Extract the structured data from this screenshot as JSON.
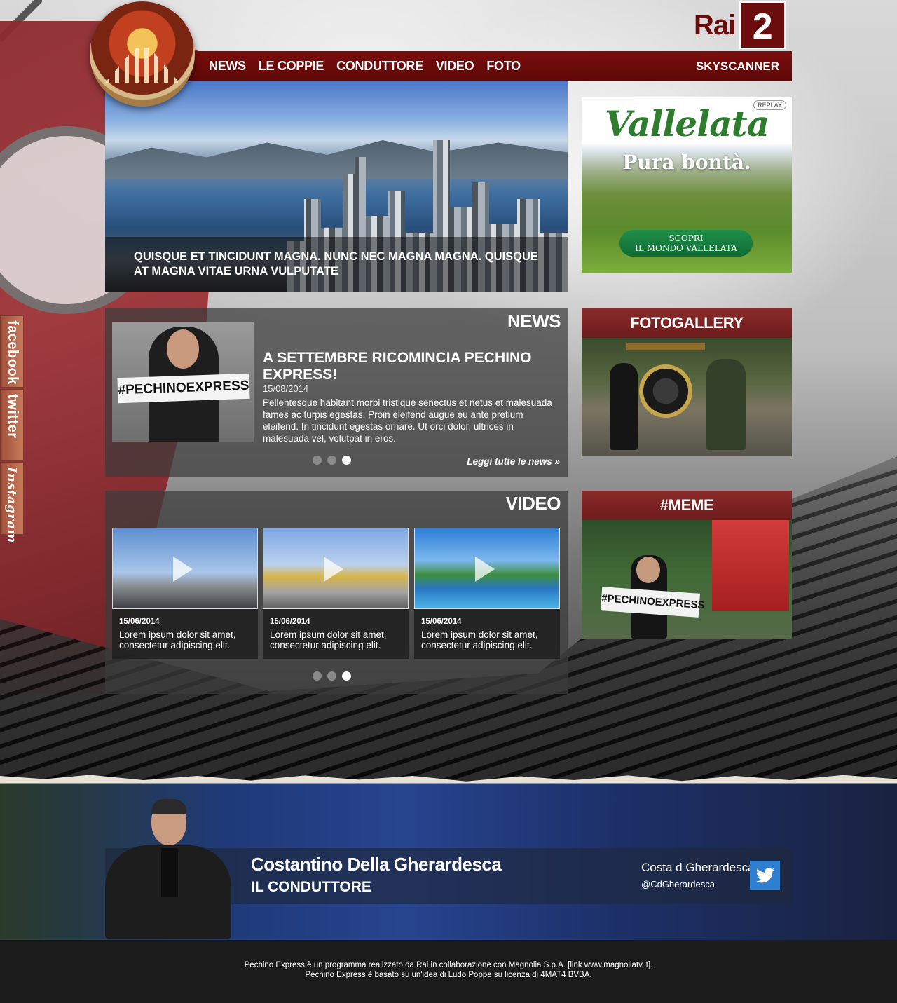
{
  "brand": {
    "channel_text": "Rai",
    "channel_number": "2"
  },
  "nav": {
    "items": [
      "NEWS",
      "LE COPPIE",
      "CONDUTTORE",
      "VIDEO",
      "FOTO"
    ],
    "right_link": "SKYSCANNER"
  },
  "hero": {
    "caption": "QUISQUE ET TINCIDUNT MAGNA. NUNC NEC MAGNA MAGNA. QUISQUE AT MAGNA VITAE URNA VULPUTATE"
  },
  "ad": {
    "brand": "Vallelata",
    "tagline": "Pura bontà.",
    "replay": "REPLAY",
    "cta_line1": "SCOPRI",
    "cta_line2": "IL MONDO VALLELATA"
  },
  "news": {
    "title": "NEWS",
    "image_sign": "#PECHINOEXPRESS",
    "headline": "A SETTEMBRE RICOMINCIA PECHINO EXPRESS!",
    "date": "15/08/2014",
    "body": "Pellentesque habitant morbi tristique senectus et netus et malesuada fames ac turpis egestas. Proin eleifend augue eu ante pretium eleifend. In tincidunt egestas ornare. Ut orci dolor, ultrices in malesuada vel, volutpat in eros.",
    "more": "Leggi tutte le news »",
    "active_slide": 3,
    "slides": 3
  },
  "video": {
    "title": "VIDEO",
    "items": [
      {
        "date": "15/06/2014",
        "text": "Lorem ipsum dolor sit amet, consectetur adipiscing elit."
      },
      {
        "date": "15/06/2014",
        "text": "Lorem ipsum dolor sit amet, consectetur adipiscing elit."
      },
      {
        "date": "15/06/2014",
        "text": "Lorem ipsum dolor sit amet, consectetur adipiscing elit."
      }
    ],
    "active_slide": 3,
    "slides": 3
  },
  "fotogallery": {
    "title": "FOTOGALLERY"
  },
  "meme": {
    "title": "#MEME",
    "image_sign": "#PECHINOEXPRESS"
  },
  "social": {
    "facebook": "facebook",
    "twitter": "twitter",
    "instagram": "Instagram"
  },
  "host": {
    "name": "Costantino Della Gherardesca",
    "role": "IL CONDUTTORE",
    "twitter_name": "Costa d Gherardesca",
    "twitter_handle": "@CdGherardesca"
  },
  "footer": {
    "line1": "Pechino Express è un programma realizzato da Rai in collaborazione con Magnolia S.p.A. [link www.magnoliatv.it].",
    "line2": "Pechino Express è basato su un'idea di Ludo Poppe su licenza di 4MAT4 BVBA."
  },
  "colors": {
    "brand_red": "#6b0d0d",
    "nav_red": "#7b0d0d",
    "side_header_red": "#8a2a2a",
    "twitter_blue": "#2f7fd0",
    "panel_grey": "#3c3c3c"
  },
  "icons": [
    "play-icon",
    "twitter-bird-icon"
  ]
}
